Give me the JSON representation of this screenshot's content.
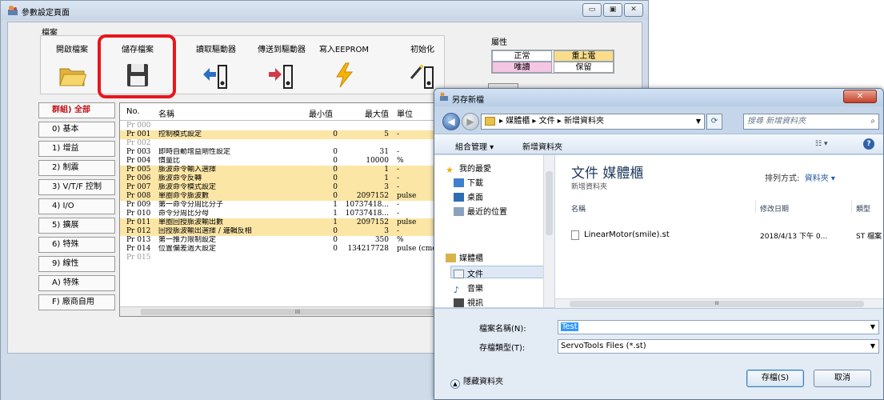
{
  "main_window": {
    "title": "參數設定頁面",
    "toolbar": {
      "group_file": "檔案",
      "open_file": "開啟檔案",
      "save_file": "儲存檔案",
      "read_drive": "讀取驅動器",
      "send_drive": "傳送到驅動器",
      "write_eeprom": "寫入EEPROM",
      "initialize": "初始化",
      "group_attr": "屬性",
      "legend": {
        "normal": "正常",
        "repower": "重上電",
        "readonly": "唯讀",
        "reserved": "保留"
      },
      "legend_colors": {
        "normal": "#ffffff",
        "repower": "#f9dd8a",
        "readonly": "#f4c6e4",
        "reserved": "#ffffff"
      }
    },
    "groups": [
      "群組) 全部",
      "0) 基本",
      "1) 增益",
      "2) 制震",
      "3) V/T/F 控制",
      "4) I/O",
      "5) 擴展",
      "6) 特殊",
      "9) 線性",
      "A) 特殊",
      "F) 廠商自用"
    ],
    "table": {
      "headers": {
        "no": "No.",
        "name": "名稱",
        "min": "最小值",
        "max": "最大值",
        "unit": "單位"
      },
      "rows": [
        {
          "no": "Pr 000",
          "name": "",
          "min": "",
          "max": "",
          "unit": "",
          "style": "dim"
        },
        {
          "no": "Pr 001",
          "name": "控制模式設定",
          "min": "0",
          "max": "5",
          "unit": "-",
          "style": "y"
        },
        {
          "no": "Pr 002",
          "name": "",
          "min": "",
          "max": "",
          "unit": "",
          "style": "dim"
        },
        {
          "no": "Pr 003",
          "name": "即時自動增益剛性設定",
          "min": "0",
          "max": "31",
          "unit": "-",
          "style": ""
        },
        {
          "no": "Pr 004",
          "name": "慣量比",
          "min": "0",
          "max": "10000",
          "unit": "%",
          "style": ""
        },
        {
          "no": "Pr 005",
          "name": "脈波命令輸入選擇",
          "min": "0",
          "max": "1",
          "unit": "-",
          "style": "y"
        },
        {
          "no": "Pr 006",
          "name": "脈波命令反轉",
          "min": "0",
          "max": "1",
          "unit": "-",
          "style": "y"
        },
        {
          "no": "Pr 007",
          "name": "脈波命令模式設定",
          "min": "0",
          "max": "3",
          "unit": "-",
          "style": "y"
        },
        {
          "no": "Pr 008",
          "name": "單圈命令脈波數",
          "min": "0",
          "max": "2097152",
          "unit": "pulse",
          "style": "y"
        },
        {
          "no": "Pr 009",
          "name": "第一命令分周比分子",
          "min": "1",
          "max": "10737418...",
          "unit": "-",
          "style": ""
        },
        {
          "no": "Pr 010",
          "name": "命令分周比分母",
          "min": "1",
          "max": "10737418...",
          "unit": "-",
          "style": ""
        },
        {
          "no": "Pr 011",
          "name": "單圈回授脈波輸出數",
          "min": "1",
          "max": "2097152",
          "unit": "pulse",
          "style": "y"
        },
        {
          "no": "Pr 012",
          "name": "回授脈波輸出選擇 / 邏輯反相",
          "min": "0",
          "max": "3",
          "unit": "-",
          "style": "y"
        },
        {
          "no": "Pr 013",
          "name": "第一推力限制設定",
          "min": "0",
          "max": "350",
          "unit": "%",
          "style": ""
        },
        {
          "no": "Pr 014",
          "name": "位置偏差過大設定",
          "min": "0",
          "max": "134217728",
          "unit": "pulse (cmd",
          "style": ""
        },
        {
          "no": "Pr 015",
          "name": "",
          "min": "",
          "max": "",
          "unit": "",
          "style": "dim"
        }
      ]
    }
  },
  "save_dialog": {
    "title": "另存新檔",
    "breadcrumb": "▸ 媒體櫃 ▸ 文件 ▸ 新增資料夾",
    "search_placeholder": "搜尋 新增資料夾",
    "commands": {
      "organize": "組合管理 ▾",
      "new_folder": "新增資料夾",
      "view": "▾"
    },
    "nav": {
      "favorites": "我的最愛",
      "downloads": "下載",
      "desktop": "桌面",
      "recent": "最近的位置",
      "libraries": "媒體櫃",
      "documents": "文件",
      "music": "音樂",
      "videos": "視訊"
    },
    "library": {
      "title": "文件 媒體櫃",
      "subtitle": "新增資料夾",
      "arrange_label": "排列方式:",
      "arrange_value": "資料夾 ▾"
    },
    "columns": {
      "name": "名稱",
      "date": "修改日期",
      "type": "類型"
    },
    "files": [
      {
        "name": "LinearMotor(smile).st",
        "date": "2018/4/13 下午 0...",
        "type": "ST 檔案"
      }
    ],
    "filename_label": "檔案名稱(N):",
    "filename_value": "Test",
    "filetype_label": "存檔類型(T):",
    "filetype_value": "ServoTools Files (*.st)",
    "hide_folders": "隱藏資料夾",
    "save_button": "存檔(S)",
    "cancel_button": "取消"
  }
}
